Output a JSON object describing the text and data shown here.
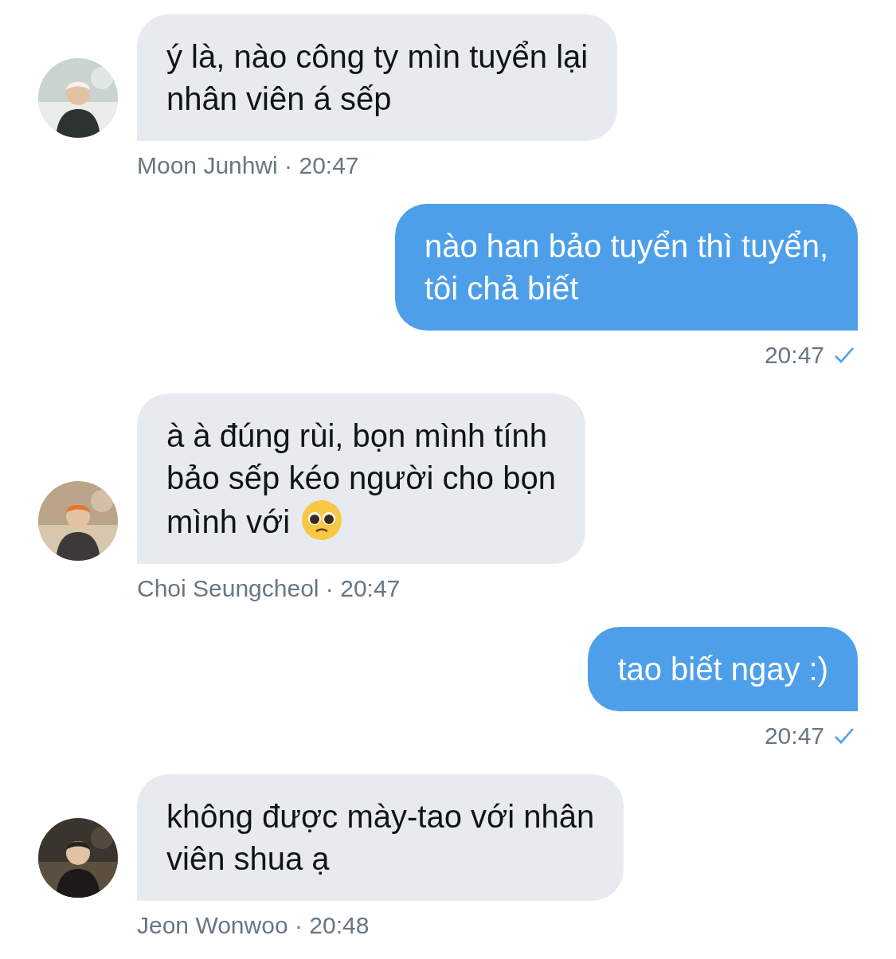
{
  "messages": [
    {
      "kind": "incoming",
      "text": "ý là, nào công ty mìn tuyển lại\nnhân viên á sếp",
      "sender": "Moon Junhwi",
      "separator": "·",
      "time": "20:47"
    },
    {
      "kind": "outgoing",
      "text": "nào han bảo tuyển thì tuyển,\ntôi chả biết",
      "time": "20:47",
      "read": true
    },
    {
      "kind": "incoming",
      "text": "à à đúng rùi, bọn mình tính\nbảo sếp kéo người cho bọn\nmình với",
      "emoji_after": true,
      "sender": "Choi Seungcheol",
      "separator": "·",
      "time": "20:47"
    },
    {
      "kind": "outgoing",
      "text": "tao biết ngay :)",
      "time": "20:47",
      "read": true
    },
    {
      "kind": "incoming",
      "text": "không được mày-tao với nhân\nviên shua ạ",
      "sender": "Jeon Wonwoo",
      "separator": "·",
      "time": "20:48"
    }
  ]
}
